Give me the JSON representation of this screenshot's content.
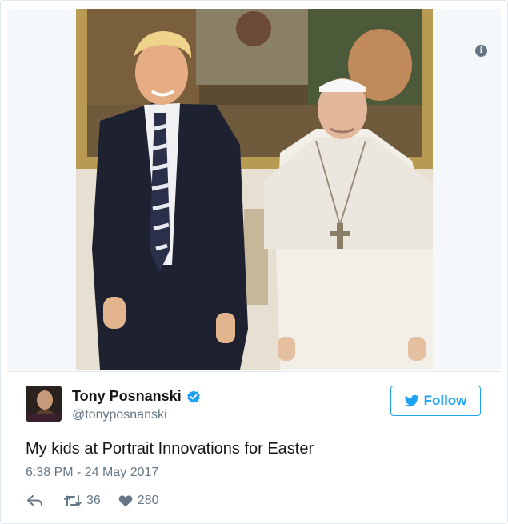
{
  "tweet": {
    "author": {
      "display_name": "Tony Posnanski",
      "handle": "@tonyposnanski",
      "verified": true,
      "avatar_icon": "profile-photo"
    },
    "text": "My kids at Portrait Innovations for Easter",
    "timestamp": "6:38 PM - 24 May 2017",
    "follow_label": "Follow",
    "stats": {
      "retweets": "36",
      "likes": "280"
    },
    "media_info_icon": "i"
  },
  "colors": {
    "accent": "#1da1f2",
    "secondary_text": "#657786",
    "border": "#e1e8ed"
  },
  "icons": {
    "reply": "reply-icon",
    "retweet": "retweet-icon",
    "like": "heart-icon",
    "verified": "verified-badge-icon",
    "follow": "bird-icon"
  }
}
